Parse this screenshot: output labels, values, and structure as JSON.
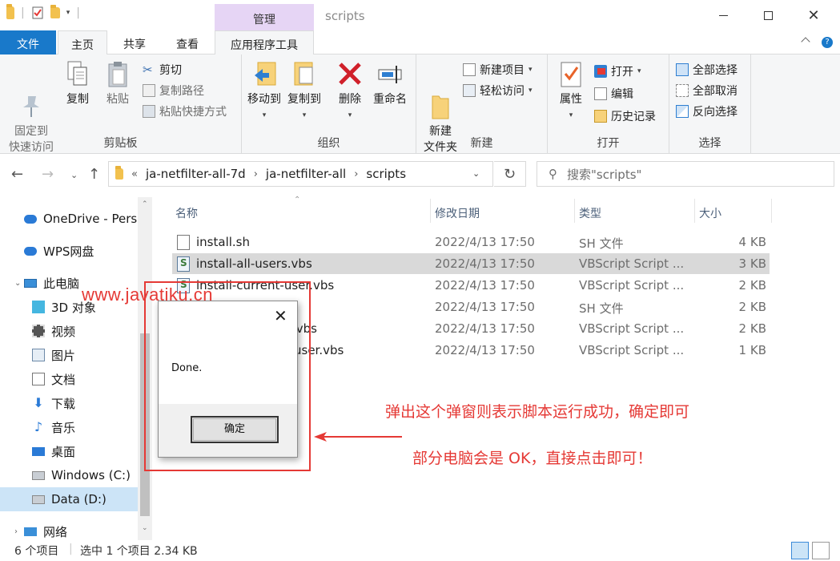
{
  "window": {
    "title": "scripts",
    "context_tab": "管理"
  },
  "tabs": [
    "文件",
    "主页",
    "共享",
    "查看",
    "应用程序工具"
  ],
  "ribbon": {
    "clipboard": {
      "label": "剪贴板",
      "pin": "固定到\n快速访问",
      "copy": "复制",
      "paste": "粘贴",
      "cut": "剪切",
      "copy_path": "复制路径",
      "paste_shortcut": "粘贴快捷方式"
    },
    "organize": {
      "label": "组织",
      "move_to": "移动到",
      "copy_to": "复制到",
      "delete": "删除",
      "rename": "重命名"
    },
    "new": {
      "label": "新建",
      "new_folder": "新建\n文件夹",
      "new_item": "新建项目",
      "easy_access": "轻松访问"
    },
    "open": {
      "label": "打开",
      "properties": "属性",
      "open": "打开",
      "edit": "编辑",
      "history": "历史记录"
    },
    "select": {
      "label": "选择",
      "select_all": "全部选择",
      "select_none": "全部取消",
      "invert": "反向选择"
    }
  },
  "address": {
    "prefix": "«",
    "crumbs": [
      "ja-netfilter-all-7d",
      "ja-netfilter-all",
      "scripts"
    ],
    "search_placeholder": "搜索\"scripts\""
  },
  "sidebar": [
    {
      "label": "OneDrive - Perso"
    },
    {
      "label": "WPS网盘"
    },
    {
      "label": "此电脑"
    },
    {
      "label": "3D 对象"
    },
    {
      "label": "视频"
    },
    {
      "label": "图片"
    },
    {
      "label": "文档"
    },
    {
      "label": "下载"
    },
    {
      "label": "音乐"
    },
    {
      "label": "桌面"
    },
    {
      "label": "Windows (C:)"
    },
    {
      "label": "Data (D:)"
    },
    {
      "label": "网络"
    }
  ],
  "columns": {
    "name": "名称",
    "modified": "修改日期",
    "type": "类型",
    "size": "大小"
  },
  "files": [
    {
      "name": "install.sh",
      "modified": "2022/4/13 17:50",
      "type": "SH 文件",
      "size": "4 KB"
    },
    {
      "name": "install-all-users.vbs",
      "modified": "2022/4/13 17:50",
      "type": "VBScript Script ...",
      "size": "3 KB"
    },
    {
      "name": "install-current-user.vbs",
      "modified": "2022/4/13 17:50",
      "type": "VBScript Script ...",
      "size": "2 KB"
    },
    {
      "name": "",
      "modified": "2022/4/13 17:50",
      "type": "SH 文件",
      "size": "2 KB"
    },
    {
      "name": ".vbs",
      "modified": "2022/4/13 17:50",
      "type": "VBScript Script ...",
      "size": "2 KB"
    },
    {
      "name": "user.vbs",
      "modified": "2022/4/13 17:50",
      "type": "VBScript Script ...",
      "size": "1 KB"
    }
  ],
  "status": {
    "count": "6 个项目",
    "selected": "选中 1 个项目  2.34 KB"
  },
  "dialog": {
    "message": "Done.",
    "ok": "确定"
  },
  "watermark": "www.javatiku.cn",
  "annotations": {
    "line1": "弹出这个弹窗则表示脚本运行成功，确定即可",
    "line2": "部分电脑会是 OK，直接点击即可！"
  }
}
